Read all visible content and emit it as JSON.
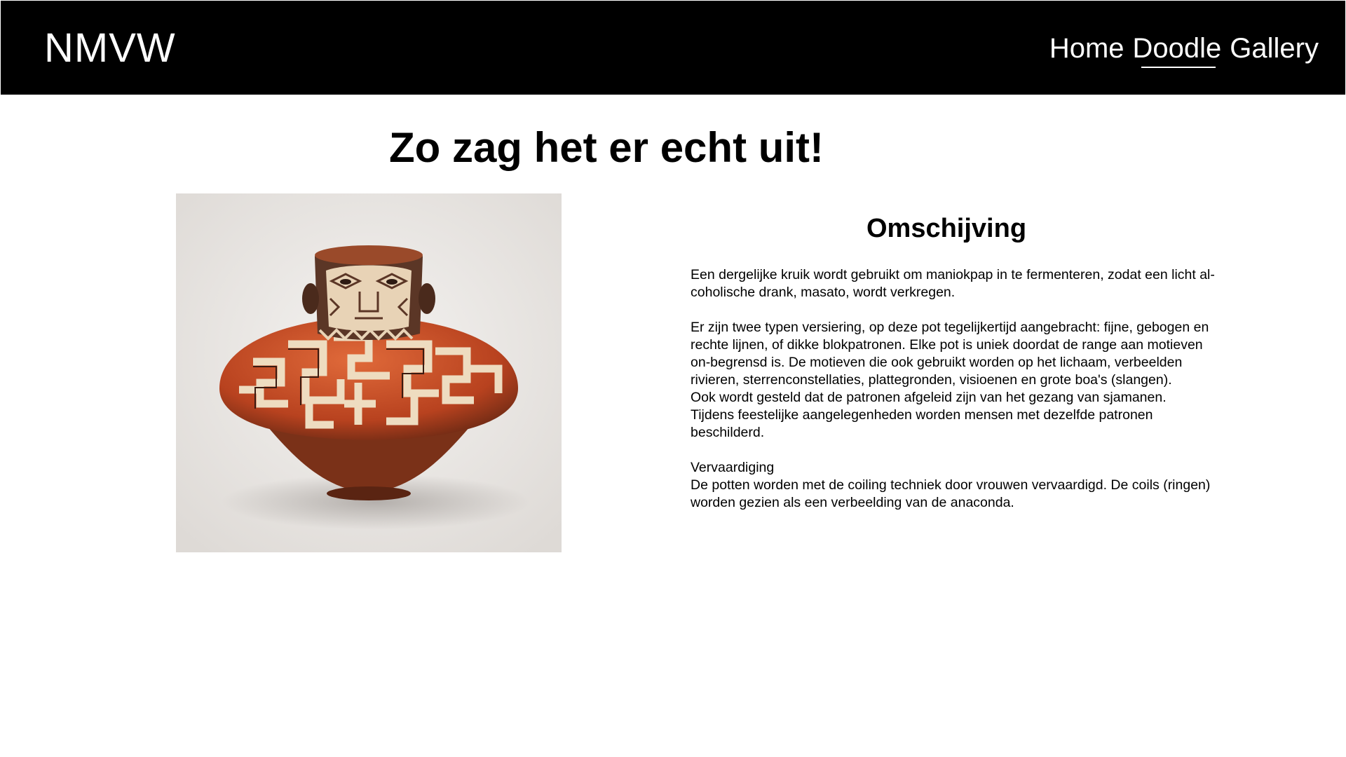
{
  "header": {
    "logo": "NMVW",
    "nav": [
      {
        "label": "Home",
        "active": false
      },
      {
        "label": "Doodle",
        "active": true
      },
      {
        "label": "Gallery",
        "active": false
      }
    ]
  },
  "main": {
    "title": "Zo zag het er echt uit!",
    "image": {
      "subject": "decorated ceramic pot with face"
    },
    "description": {
      "heading": "Omschijving",
      "paragraph1": "Een dergelijke kruik wordt gebruikt om maniokpap in te fermenteren, zodat een licht al-coholische drank, masato, wordt verkregen.",
      "paragraph2_lines": [
        "Er zijn twee typen versiering, op deze pot tegelijkertijd aangebracht: fijne, gebogen en rechte lijnen, of dikke blokpatronen. Elke pot is uniek doordat de range aan motieven on-begrensd is. De motieven die ook gebruikt worden op het lichaam, verbeelden rivieren, sterrenconstellaties, plattegronden, visioenen en grote boa's (slangen).",
        "Ook wordt gesteld dat de patronen afgeleid zijn van het gezang van sjamanen.",
        "Tijdens feestelijke aangelegenheden worden mensen met dezelfde patronen beschilderd."
      ],
      "subheading": "Vervaardiging",
      "paragraph3": "De potten worden met de coiling techniek door vrouwen vervaardigd. De coils (ringen) worden gezien als een verbeelding van de anaconda."
    }
  }
}
